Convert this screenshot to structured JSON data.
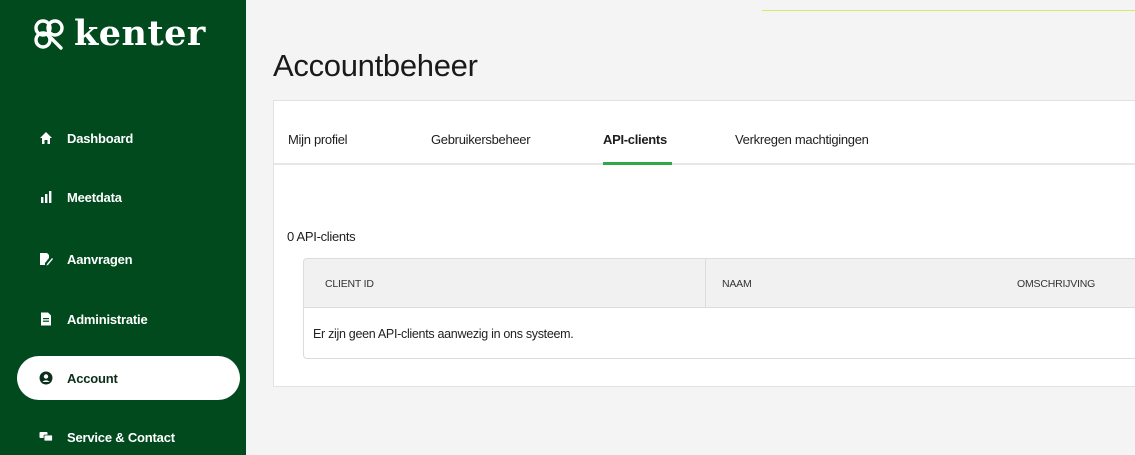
{
  "brand": {
    "name": "kenter",
    "logo_icon": "kenter-logo-icon"
  },
  "sidebar": {
    "items": [
      {
        "label": "Dashboard",
        "icon": "home-icon"
      },
      {
        "label": "Meetdata",
        "icon": "bar-chart-icon"
      },
      {
        "label": "Aanvragen",
        "icon": "document-edit-icon"
      },
      {
        "label": "Administratie",
        "icon": "document-icon"
      },
      {
        "label": "Account",
        "icon": "user-circle-icon",
        "active": true
      },
      {
        "label": "Service & Contact",
        "icon": "chat-icon"
      }
    ]
  },
  "page": {
    "title": "Accountbeheer"
  },
  "tabs": [
    {
      "label": "Mijn profiel"
    },
    {
      "label": "Gebruikersbeheer"
    },
    {
      "label": "API-clients",
      "active": true
    },
    {
      "label": "Verkregen machtigingen"
    }
  ],
  "api_clients": {
    "count_label": "0 API-clients",
    "columns": [
      "CLIENT ID",
      "NAAM",
      "OMSCHRIJVING"
    ],
    "empty_message": "Er zijn geen API-clients aanwezig in ons systeem."
  },
  "colors": {
    "sidebar_bg": "#004a1e",
    "accent_green": "#2fa84a",
    "main_bg": "#f4f4f5"
  }
}
